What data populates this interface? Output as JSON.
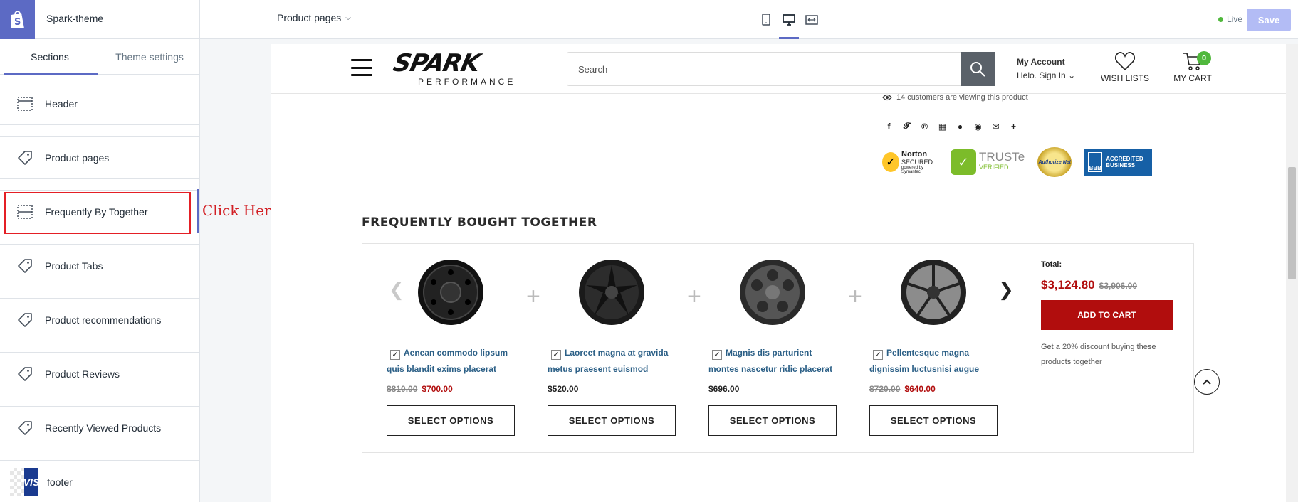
{
  "topbar": {
    "theme_name": "Spark-theme",
    "page_select": "Product pages",
    "live_label": "Live",
    "save_label": "Save"
  },
  "sidebar": {
    "tabs": [
      {
        "label": "Sections",
        "active": true
      },
      {
        "label": "Theme settings",
        "active": false
      }
    ],
    "items": [
      {
        "label": "Header",
        "icon": "layout-icon"
      },
      {
        "label": "Product pages",
        "icon": "tag-icon"
      },
      {
        "label": "Frequently By Together",
        "icon": "layout-icon",
        "highlighted": true
      },
      {
        "label": "Product Tabs",
        "icon": "tag-icon"
      },
      {
        "label": "Product recommendations",
        "icon": "tag-icon"
      },
      {
        "label": "Product Reviews",
        "icon": "tag-icon"
      },
      {
        "label": "Recently Viewed Products",
        "icon": "tag-icon"
      },
      {
        "label": "footer",
        "icon": "footer-thumbnail",
        "thumb_text": "VIS"
      }
    ]
  },
  "annotation": {
    "text": "Click Here",
    "color": "#d21f24"
  },
  "store": {
    "brand_main": "SPARK",
    "brand_sub": "PERFORMANCE",
    "search_placeholder": "Search",
    "account_title": "My Account",
    "account_sub": "Helo. Sign In",
    "wishlist_label": "WISH LISTS",
    "cart_label": "MY CART",
    "cart_count": "0",
    "viewing_text": "14 customers are viewing this product",
    "social_icons": [
      "facebook-icon",
      "twitter-icon",
      "pinterest-icon",
      "grid-icon",
      "snapchat-icon",
      "reddit-icon",
      "email-icon",
      "plus-icon"
    ],
    "badges": {
      "norton_title": "Norton",
      "norton_sub": "SECURED",
      "norton_powered": "powered by Symantec",
      "truste_title": "TRUSTe",
      "truste_sub": "VERIFIED",
      "authorize": "Authorize.Net",
      "bbb_text_1": "ACCREDITED",
      "bbb_text_2": "BUSINESS",
      "bbb_logo": "BBB"
    }
  },
  "fbt": {
    "title": "FREQUENTLY BOUGHT TOGETHER",
    "products": [
      {
        "name": "Aenean commodo lipsum quis blandit exims placerat",
        "old_price": "$810.00",
        "price": "$700.00",
        "on_sale": true,
        "checked": true,
        "button": "SELECT OPTIONS"
      },
      {
        "name": "Laoreet magna at gravida metus praesent euismod",
        "old_price": "",
        "price": "$520.00",
        "on_sale": false,
        "checked": true,
        "button": "SELECT OPTIONS"
      },
      {
        "name": "Magnis dis parturient montes nascetur ridic placerat",
        "old_price": "",
        "price": "$696.00",
        "on_sale": false,
        "checked": true,
        "button": "SELECT OPTIONS"
      },
      {
        "name": "Pellentesque magna dignissim luctusnisi augue",
        "old_price": "$720.00",
        "price": "$640.00",
        "on_sale": true,
        "checked": true,
        "button": "SELECT OPTIONS"
      }
    ],
    "total_label": "Total:",
    "total_price": "$3,124.80",
    "total_old_price": "$3,906.00",
    "add_to_cart": "ADD TO CART",
    "discount_note": "Get a 20% discount buying these products together"
  },
  "colors": {
    "accent": "#5c6ac4",
    "sale": "#b10d0d",
    "live": "#50b83c",
    "link": "#2b5f86"
  }
}
